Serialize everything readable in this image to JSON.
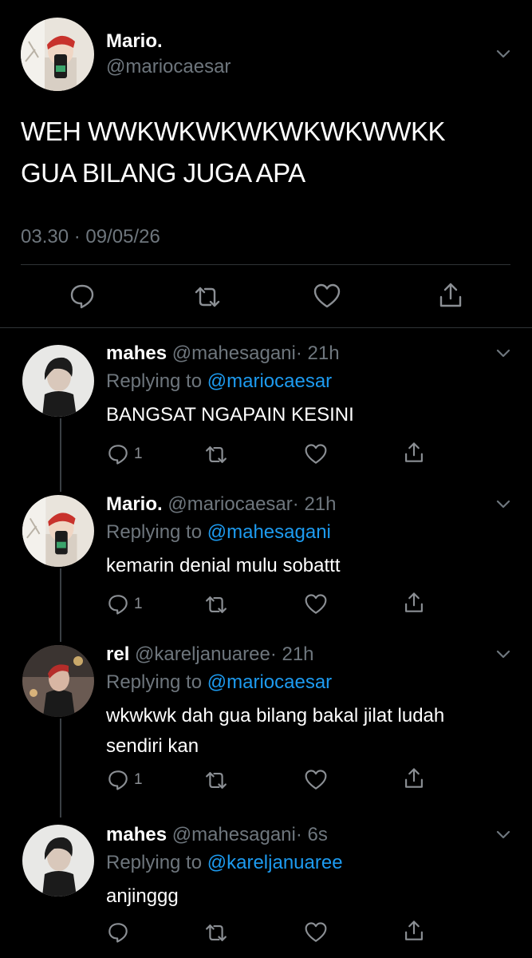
{
  "main_tweet": {
    "display_name": "Mario.",
    "handle": "@mariocaesar",
    "text_line1": "WEH WWKWKWKWKWKWKWWKK",
    "text_line2": "GUA BILANG JUGA APA",
    "timestamp": "03.30 · 09/05/26"
  },
  "replies": [
    {
      "display_name": "mahes",
      "handle": "@mahesagani",
      "time": "· 21h",
      "replying_label": "Replying to",
      "replying_to": "@mariocaesar",
      "text_line1": "BANGSAT NGAPAIN KESINI",
      "text_line2": "",
      "reply_count": "1"
    },
    {
      "display_name": "Mario.",
      "handle": "@mariocaesar",
      "time": "· 21h",
      "replying_label": "Replying to",
      "replying_to": "@mahesagani",
      "text_line1": "kemarin denial mulu sobattt",
      "text_line2": "",
      "reply_count": "1"
    },
    {
      "display_name": "rel",
      "handle": "@kareljanuaree",
      "time": "· 21h",
      "replying_label": "Replying to",
      "replying_to": "@mariocaesar",
      "text_line1": "wkwkwk dah gua bilang bakal jilat ludah",
      "text_line2": "sendiri kan",
      "reply_count": "1"
    },
    {
      "display_name": "mahes",
      "handle": "@mahesagani",
      "time": "· 6s",
      "replying_label": "Replying to",
      "replying_to": "@kareljanuaree",
      "text_line1": "anjinggg",
      "text_line2": "",
      "reply_count": ""
    }
  ],
  "colors": {
    "background": "#000000",
    "link": "#1d9bf0",
    "muted": "#6e767d",
    "divider": "#2f3336"
  },
  "icons": [
    "reply-icon",
    "retweet-icon",
    "like-icon",
    "share-icon",
    "chevron-down-icon"
  ]
}
